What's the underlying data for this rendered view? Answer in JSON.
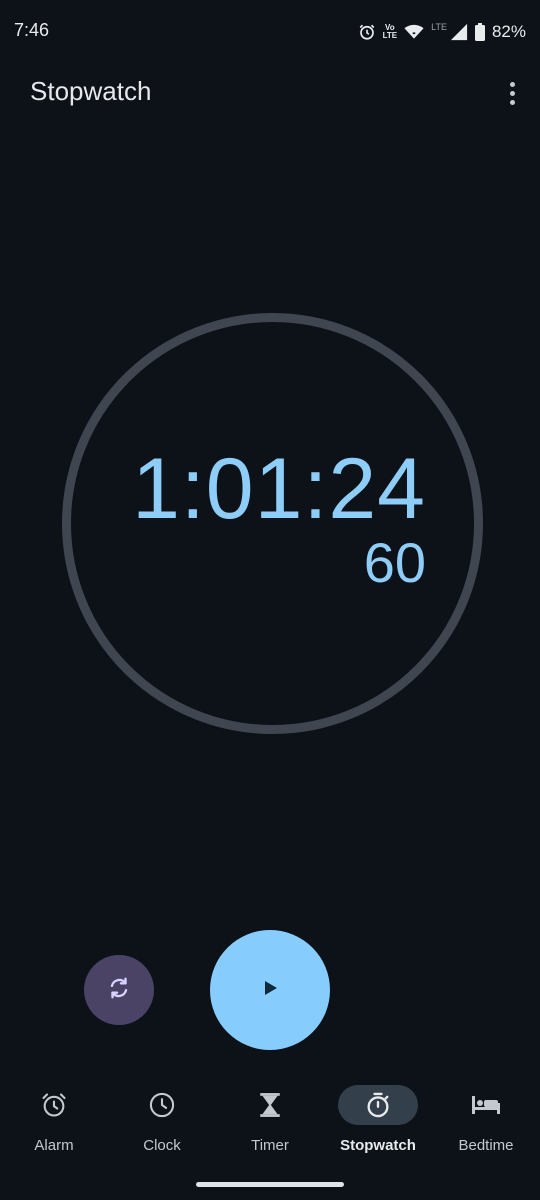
{
  "status_bar": {
    "time": "7:46",
    "volte_top": "Vo",
    "volte_bottom": "LTE",
    "network_type": "LTE",
    "battery_percent": "82%",
    "icons": [
      "alarm-icon",
      "volte-icon",
      "wifi-icon",
      "signal-icon",
      "battery-icon"
    ]
  },
  "app_bar": {
    "title": "Stopwatch",
    "menu_icon": "more-vert-icon"
  },
  "stopwatch": {
    "elapsed": "1:01:24",
    "hundredths": "60"
  },
  "controls": {
    "reset_icon": "reset-icon",
    "play_icon": "play-icon"
  },
  "nav": {
    "items": [
      {
        "label": "Alarm",
        "icon": "alarm-icon"
      },
      {
        "label": "Clock",
        "icon": "clock-icon"
      },
      {
        "label": "Timer",
        "icon": "hourglass-icon"
      },
      {
        "label": "Stopwatch",
        "icon": "stopwatch-icon",
        "active": true
      },
      {
        "label": "Bedtime",
        "icon": "bed-icon"
      }
    ]
  },
  "colors": {
    "background": "#0d1218",
    "accent": "#86cdfd",
    "time_text": "#8ecdf8",
    "reset_button": "#4b4366",
    "dial_ring": "#3f4650",
    "active_pill": "#33404b"
  }
}
